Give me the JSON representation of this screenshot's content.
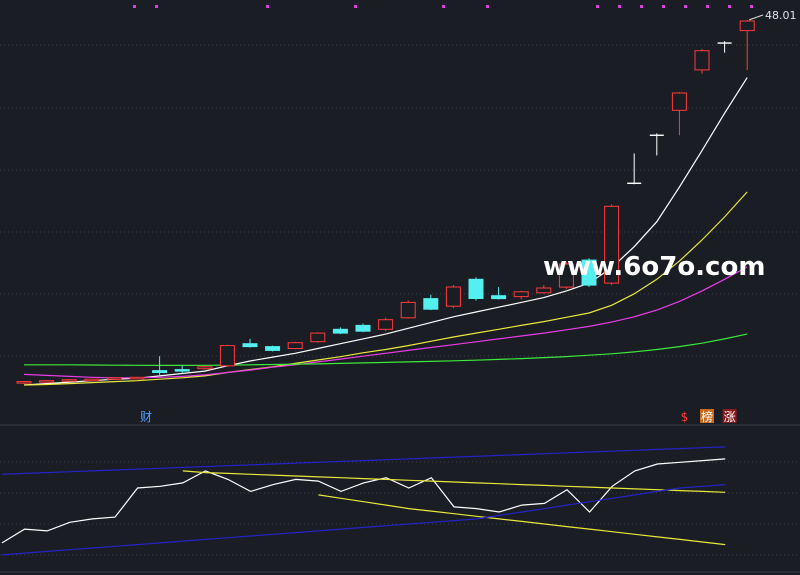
{
  "chart_data": [
    {
      "type": "candlestick",
      "price_labels": {
        "last_high": "48.01"
      },
      "candles": [
        {
          "o": 10.2,
          "c": 10.35,
          "h": 10.4,
          "l": 10.1
        },
        {
          "o": 10.3,
          "c": 10.45,
          "h": 10.5,
          "l": 10.25
        },
        {
          "o": 10.4,
          "c": 10.55,
          "h": 10.6,
          "l": 10.35
        },
        {
          "o": 10.5,
          "c": 10.6,
          "h": 10.65,
          "l": 10.45
        },
        {
          "o": 10.6,
          "c": 10.75,
          "h": 10.8,
          "l": 10.55
        },
        {
          "o": 10.7,
          "c": 10.8,
          "h": 10.85,
          "l": 10.6
        },
        {
          "o": 11.5,
          "c": 11.3,
          "h": 13.0,
          "l": 10.9
        },
        {
          "o": 11.6,
          "c": 11.5,
          "h": 12.0,
          "l": 11.2
        },
        {
          "o": 11.7,
          "c": 11.9,
          "h": 12.0,
          "l": 11.6
        },
        {
          "o": 12.0,
          "c": 14.1,
          "h": 14.2,
          "l": 11.9
        },
        {
          "o": 14.3,
          "c": 14.0,
          "h": 14.8,
          "l": 13.9
        },
        {
          "o": 14.0,
          "c": 13.6,
          "h": 14.1,
          "l": 13.5
        },
        {
          "o": 13.8,
          "c": 14.4,
          "h": 14.5,
          "l": 13.7
        },
        {
          "o": 14.5,
          "c": 15.4,
          "h": 15.5,
          "l": 14.4
        },
        {
          "o": 15.8,
          "c": 15.4,
          "h": 16.0,
          "l": 15.3
        },
        {
          "o": 16.2,
          "c": 15.6,
          "h": 16.4,
          "l": 15.5
        },
        {
          "o": 15.8,
          "c": 16.8,
          "h": 17.0,
          "l": 15.6
        },
        {
          "o": 17.0,
          "c": 18.6,
          "h": 18.8,
          "l": 16.9
        },
        {
          "o": 19.0,
          "c": 17.9,
          "h": 19.4,
          "l": 17.8
        },
        {
          "o": 18.2,
          "c": 20.2,
          "h": 20.4,
          "l": 18.0
        },
        {
          "o": 21.0,
          "c": 19.0,
          "h": 21.2,
          "l": 18.8
        },
        {
          "o": 19.3,
          "c": 19.0,
          "h": 20.2,
          "l": 18.9
        },
        {
          "o": 19.2,
          "c": 19.7,
          "h": 19.8,
          "l": 18.9
        },
        {
          "o": 19.6,
          "c": 20.1,
          "h": 20.4,
          "l": 19.5
        },
        {
          "o": 20.2,
          "c": 22.6,
          "h": 22.8,
          "l": 20.0
        },
        {
          "o": 23.0,
          "c": 20.4,
          "h": 23.2,
          "l": 20.2
        },
        {
          "o": 20.6,
          "c": 28.6,
          "h": 28.8,
          "l": 20.4
        },
        {
          "o": 31.0,
          "c": 31.0,
          "h": 34.1,
          "l": 30.9
        },
        {
          "o": 36.0,
          "c": 36.0,
          "h": 36.2,
          "l": 33.9
        },
        {
          "o": 38.6,
          "c": 40.4,
          "h": 40.5,
          "l": 36.0
        },
        {
          "o": 42.8,
          "c": 44.8,
          "h": 45.0,
          "l": 42.4
        },
        {
          "o": 45.6,
          "c": 45.6,
          "h": 45.8,
          "l": 44.6
        },
        {
          "o": 46.9,
          "c": 47.9,
          "h": 48.01,
          "l": 42.8
        }
      ],
      "ma": [
        {
          "color": "#ffffff",
          "values": [
            10.0,
            10.15,
            10.3,
            10.45,
            10.6,
            10.7,
            10.95,
            11.2,
            11.45,
            12.0,
            12.5,
            12.9,
            13.3,
            13.8,
            14.3,
            14.8,
            15.3,
            15.9,
            16.5,
            17.1,
            17.6,
            18.1,
            18.6,
            19.1,
            19.8,
            20.6,
            22.2,
            24.4,
            27.0,
            30.6,
            34.4,
            38.3,
            42.0
          ]
        },
        {
          "color": "#e8e83c",
          "values": [
            10.0,
            10.05,
            10.15,
            10.25,
            10.35,
            10.45,
            10.6,
            10.75,
            10.95,
            11.3,
            11.6,
            11.9,
            12.25,
            12.6,
            12.95,
            13.35,
            13.7,
            14.1,
            14.55,
            15.0,
            15.4,
            15.8,
            16.2,
            16.6,
            17.05,
            17.5,
            18.3,
            19.5,
            21.0,
            22.9,
            25.1,
            27.5,
            30.1
          ]
        },
        {
          "color": "#e83ce8",
          "values": [
            11.1,
            11.0,
            10.9,
            10.8,
            10.75,
            10.75,
            10.8,
            10.9,
            11.05,
            11.3,
            11.55,
            11.85,
            12.1,
            12.4,
            12.7,
            13.0,
            13.3,
            13.6,
            13.9,
            14.2,
            14.5,
            14.8,
            15.1,
            15.4,
            15.75,
            16.1,
            16.55,
            17.1,
            17.8,
            18.7,
            19.8,
            21.0,
            22.3
          ]
        },
        {
          "color": "#3ce83c",
          "values": [
            12.1,
            12.1,
            12.1,
            12.08,
            12.06,
            12.05,
            12.04,
            12.04,
            12.05,
            12.07,
            12.1,
            12.13,
            12.17,
            12.2,
            12.25,
            12.3,
            12.35,
            12.4,
            12.46,
            12.52,
            12.58,
            12.66,
            12.75,
            12.85,
            12.96,
            13.1,
            13.25,
            13.45,
            13.7,
            14.0,
            14.35,
            14.8,
            15.3
          ]
        }
      ],
      "event_markers": [
        "财",
        "$",
        "榜",
        "涨"
      ]
    },
    {
      "type": "line",
      "series": [
        {
          "color": "#ffffff",
          "values": [
            10,
            18,
            17,
            22,
            24,
            25,
            42,
            43,
            45,
            52,
            47,
            40,
            44,
            47,
            46,
            40,
            45,
            48,
            42,
            48,
            31,
            30,
            28,
            32,
            33,
            41,
            28,
            43,
            52,
            56,
            57,
            58,
            59
          ]
        },
        {
          "color": "#e8e83c",
          "values": [
            null,
            null,
            null,
            null,
            null,
            null,
            null,
            null,
            52,
            51,
            50.5,
            50,
            49.5,
            49,
            48.5,
            48,
            47.5,
            47,
            46.5,
            46,
            45.5,
            45,
            44.5,
            44,
            43.5,
            43,
            42.5,
            42,
            41.5,
            41,
            40.5,
            40,
            39.5
          ]
        },
        {
          "color": "#e8e83c",
          "values": [
            null,
            null,
            null,
            null,
            null,
            null,
            null,
            null,
            null,
            null,
            null,
            null,
            null,
            null,
            38,
            36,
            34,
            32,
            30,
            28.5,
            27,
            25.5,
            24,
            22.5,
            21,
            19.5,
            18,
            16.5,
            15,
            13.5,
            12,
            10.5,
            9
          ]
        },
        {
          "color": "#2323c8",
          "values": [
            3,
            4,
            5,
            6,
            7,
            8,
            9,
            10,
            11,
            12,
            13,
            14,
            15,
            16,
            17,
            18,
            19,
            20,
            21,
            22,
            23,
            24,
            26,
            28,
            30,
            32,
            34,
            36,
            38,
            40,
            42,
            43,
            44
          ]
        },
        {
          "color": "#2323c8",
          "values": [
            50,
            50.5,
            51,
            51.5,
            52,
            52.5,
            53,
            53.5,
            54,
            54.5,
            55,
            55.5,
            56,
            56.5,
            57,
            57.5,
            58,
            58.5,
            59,
            59.5,
            60,
            60.5,
            61,
            61.5,
            62,
            62.5,
            63,
            63.5,
            64,
            64.5,
            65,
            65.5,
            66
          ]
        }
      ]
    }
  ],
  "watermark": "www.6o7o.com"
}
